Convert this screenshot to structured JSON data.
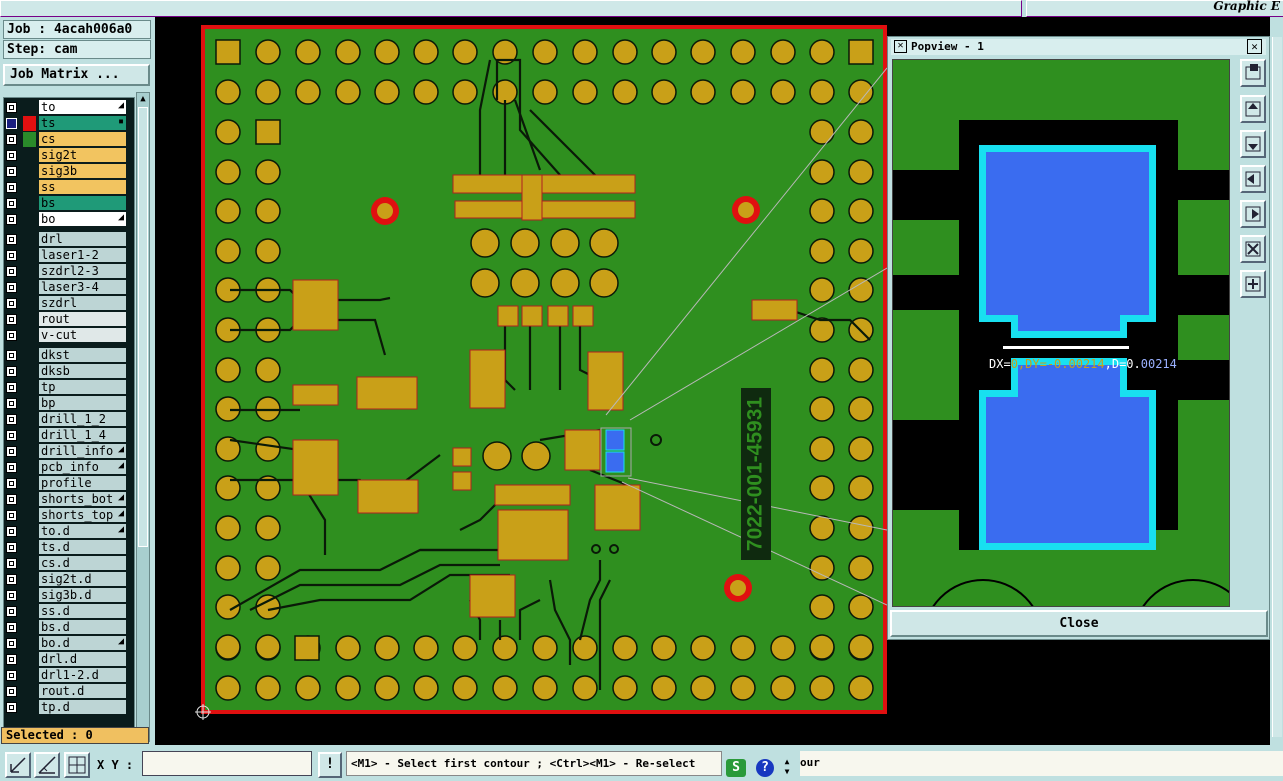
{
  "header": {
    "job": "Job : 4acah006a0",
    "step": "Step: cam",
    "job_matrix": "Job Matrix ...",
    "top_right_text": "Graphic E"
  },
  "layers": [
    {
      "name": "to",
      "bg": "#ffffff",
      "marker": "◢"
    },
    {
      "name": "ts",
      "bg": "#1f9a78",
      "marker": "▪",
      "active": true
    },
    {
      "name": "cs",
      "bg": "#f2c460",
      "marker": ""
    },
    {
      "name": "sig2t",
      "bg": "#f2c460",
      "marker": ""
    },
    {
      "name": "sig3b",
      "bg": "#f2c460",
      "marker": ""
    },
    {
      "name": "ss",
      "bg": "#f2c460",
      "marker": ""
    },
    {
      "name": "bs",
      "bg": "#1f9a78",
      "marker": ""
    },
    {
      "name": "bo",
      "bg": "#ffffff",
      "marker": "◢"
    },
    {
      "name": "drl",
      "bg": "#bdd5d5",
      "marker": ""
    },
    {
      "name": "laser1-2",
      "bg": "#bdd5d5",
      "marker": ""
    },
    {
      "name": "szdrl2-3",
      "bg": "#bdd5d5",
      "marker": ""
    },
    {
      "name": "laser3-4",
      "bg": "#bdd5d5",
      "marker": ""
    },
    {
      "name": "szdrl",
      "bg": "#bdd5d5",
      "marker": ""
    },
    {
      "name": "rout",
      "bg": "#e0e8e8",
      "marker": ""
    },
    {
      "name": "v-cut",
      "bg": "#e0e8e8",
      "marker": ""
    },
    {
      "name": "dkst",
      "bg": "#bdd5d5",
      "marker": ""
    },
    {
      "name": "dksb",
      "bg": "#bdd5d5",
      "marker": ""
    },
    {
      "name": "tp",
      "bg": "#bdd5d5",
      "marker": ""
    },
    {
      "name": "bp",
      "bg": "#bdd5d5",
      "marker": ""
    },
    {
      "name": "drill_1_2",
      "bg": "#bdd5d5",
      "marker": ""
    },
    {
      "name": "drill_1_4",
      "bg": "#bdd5d5",
      "marker": ""
    },
    {
      "name": "drill_info",
      "bg": "#bdd5d5",
      "marker": "◢"
    },
    {
      "name": "pcb_info",
      "bg": "#bdd5d5",
      "marker": "◢"
    },
    {
      "name": "profile",
      "bg": "#bdd5d5",
      "marker": ""
    },
    {
      "name": "shorts_bot",
      "bg": "#bdd5d5",
      "marker": "◢"
    },
    {
      "name": "shorts_top",
      "bg": "#bdd5d5",
      "marker": "◢"
    },
    {
      "name": "to.d",
      "bg": "#bdd5d5",
      "marker": "◢"
    },
    {
      "name": "ts.d",
      "bg": "#bdd5d5",
      "marker": ""
    },
    {
      "name": "cs.d",
      "bg": "#bdd5d5",
      "marker": ""
    },
    {
      "name": "sig2t.d",
      "bg": "#bdd5d5",
      "marker": ""
    },
    {
      "name": "sig3b.d",
      "bg": "#bdd5d5",
      "marker": ""
    },
    {
      "name": "ss.d",
      "bg": "#bdd5d5",
      "marker": ""
    },
    {
      "name": "bs.d",
      "bg": "#bdd5d5",
      "marker": ""
    },
    {
      "name": "bo.d",
      "bg": "#bdd5d5",
      "marker": "◢"
    },
    {
      "name": "drl.d",
      "bg": "#bdd5d5",
      "marker": ""
    },
    {
      "name": "drl1-2.d",
      "bg": "#bdd5d5",
      "marker": ""
    },
    {
      "name": "rout.d",
      "bg": "#bdd5d5",
      "marker": ""
    },
    {
      "name": "tp.d",
      "bg": "#bdd5d5",
      "marker": ""
    }
  ],
  "status": {
    "selected": "Selected : 0",
    "xy_label": "X Y :",
    "xy_value": "",
    "message": "<M1> - Select first contour ; <Ctrl><M1> - Re-select",
    "message_tail": "our",
    "info_icon": "!"
  },
  "board": {
    "part_number": "7022-001-45931"
  },
  "popview": {
    "title": "Popview - 1",
    "measure_prefix": "DX=",
    "measure_dx": "0",
    "measure_sep": ",DY=",
    "measure_dy": "-0.00214",
    "measure_tail": ",D=0.",
    "measure_d": "00214",
    "close_label": "Close"
  },
  "colors": {
    "board_green": "#2f8f1f",
    "pad_gold": "#c9a018",
    "profile_red": "#e01010",
    "copper_blue": "#3a6cf0",
    "outline_cyan": "#18e0f0"
  }
}
